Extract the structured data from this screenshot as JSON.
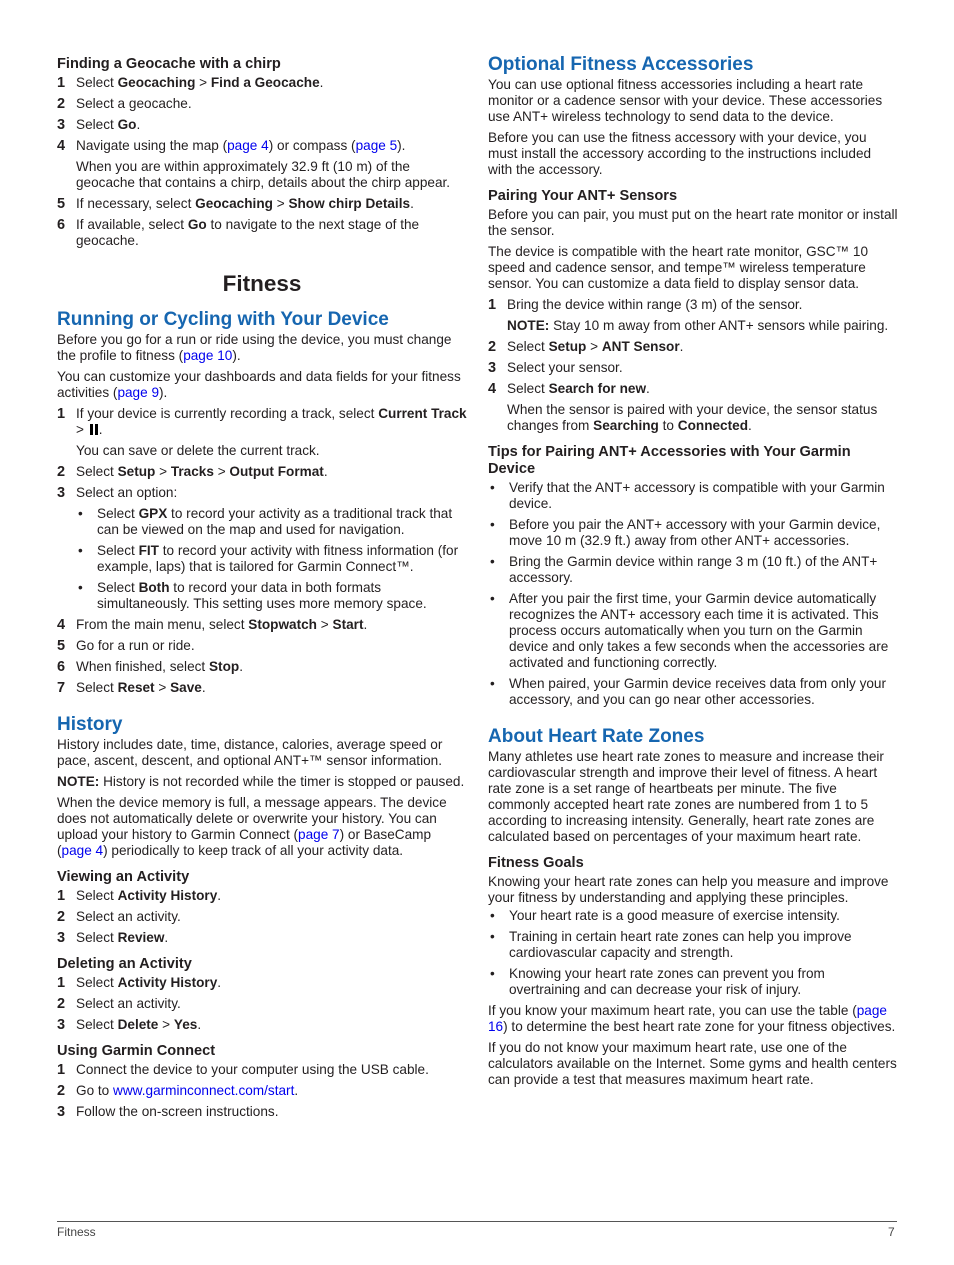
{
  "left": {
    "chirp": {
      "title": "Finding a Geocache with a chirp",
      "steps": [
        {
          "n": "1",
          "a": "Select ",
          "b1": "Geocaching",
          "c": " > ",
          "b2": "Find a Geocache",
          "d": "."
        },
        {
          "n": "2",
          "text": "Select a geocache."
        },
        {
          "n": "3",
          "a": "Select ",
          "b1": "Go",
          "d": "."
        },
        {
          "n": "4",
          "a": "Navigate using the map (",
          "link1": "page 4",
          "c": ") or compass (",
          "link2": "page 5",
          "d": ")."
        },
        {
          "n": "5",
          "a": "If necessary, select ",
          "b1": "Geocaching",
          "c": " > ",
          "b2": "Show chirp Details",
          "d": "."
        },
        {
          "n": "6",
          "a": "If available, select ",
          "b1": "Go",
          "d": " to navigate to the next stage of the geocache."
        }
      ],
      "step4_note": "When you are within approximately 32.9 ft (10 m) of the geocache that contains a chirp, details about the chirp appear."
    },
    "chapter_title": "Fitness",
    "running": {
      "title": "Running or Cycling with Your Device",
      "p1a": "Before you go for a run or ride using the device, you must change the profile to fitness (",
      "p1link": "page 10",
      "p1b": ").",
      "p2a": "You can customize your dashboards and data fields for your fitness activities (",
      "p2link": "page 9",
      "p2b": ").",
      "s1": {
        "n": "1",
        "a": "If your device is currently recording a track, select ",
        "b1": "Current Track",
        "c": " > ",
        "d": "."
      },
      "s1_note": "You can save or delete the current track.",
      "s2": {
        "n": "2",
        "a": "Select ",
        "b1": "Setup",
        "c1": " > ",
        "b2": "Tracks",
        "c2": " > ",
        "b3": "Output Format",
        "d": "."
      },
      "s3": {
        "n": "3",
        "text": "Select an option:"
      },
      "options": [
        {
          "a": "Select ",
          "b": "GPX",
          "c": " to record your activity as a traditional track that can be viewed on the map and used for navigation."
        },
        {
          "a": "Select ",
          "b": "FIT",
          "c": " to record your activity with fitness information (for example, laps) that is tailored for Garmin Connect™."
        },
        {
          "a": "Select ",
          "b": "Both",
          "c": " to record your data in both formats simultaneously. This setting uses more memory space."
        }
      ],
      "s4": {
        "n": "4",
        "a": "From the main menu, select ",
        "b1": "Stopwatch",
        "c": " > ",
        "b2": "Start",
        "d": "."
      },
      "s5": {
        "n": "5",
        "text": "Go for a run or ride."
      },
      "s6": {
        "n": "6",
        "a": "When finished, select ",
        "b1": "Stop",
        "d": "."
      },
      "s7": {
        "n": "7",
        "a": "Select ",
        "b1": "Reset",
        "c": " > ",
        "b2": "Save",
        "d": "."
      }
    },
    "history": {
      "title": "History",
      "p1": "History includes date, time, distance, calories, average speed or pace, ascent, descent, and optional ANT+™ sensor information.",
      "note_label": "NOTE:",
      "note_text": " History is not recorded while the timer is stopped or paused.",
      "p3a": "When the device memory is full, a message appears. The device does not automatically delete or overwrite your history. You can upload your history to Garmin Connect (",
      "p3link1": "page 7",
      "p3b": ") or BaseCamp (",
      "p3link2": "page 4",
      "p3c": ") periodically to keep track of all your activity data."
    },
    "viewing": {
      "title": "Viewing an Activity",
      "s1": {
        "n": "1",
        "a": "Select ",
        "b1": "Activity History",
        "d": "."
      },
      "s2": {
        "n": "2",
        "text": "Select an activity."
      },
      "s3": {
        "n": "3",
        "a": "Select ",
        "b1": "Review",
        "d": "."
      }
    },
    "deleting": {
      "title": "Deleting an Activity",
      "s1": {
        "n": "1",
        "a": "Select ",
        "b1": "Activity History",
        "d": "."
      },
      "s2": {
        "n": "2",
        "text": "Select an activity."
      },
      "s3": {
        "n": "3",
        "a": "Select ",
        "b1": "Delete",
        "c": " > ",
        "b2": "Yes",
        "d": "."
      }
    },
    "connect": {
      "title": "Using Garmin Connect",
      "s1": {
        "n": "1",
        "text": "Connect the device to your computer using the USB cable."
      },
      "s2": {
        "n": "2",
        "a": "Go to ",
        "link": "www.garminconnect.com/start",
        "d": "."
      },
      "s3": {
        "n": "3",
        "text": "Follow the on-screen instructions."
      }
    }
  },
  "right": {
    "accessories": {
      "title": "Optional Fitness Accessories",
      "p1": "You can use optional fitness accessories including a heart rate monitor or a cadence sensor with your device. These accessories use ANT+ wireless technology to send data to the device.",
      "p2": "Before you can use the fitness accessory with your device, you must install the accessory according to the instructions included with the accessory."
    },
    "pairing": {
      "title": "Pairing Your ANT+ Sensors",
      "p1": "Before you can pair, you must put on the heart rate monitor or install the sensor.",
      "p2": "The device is compatible with the heart rate monitor, GSC™ 10 speed and cadence sensor, and tempe™ wireless temperature sensor. You can customize a data field to display sensor data.",
      "s1": {
        "n": "1",
        "text": "Bring the device within range (3 m) of the sensor."
      },
      "s1_note_label": "NOTE:",
      "s1_note_text": " Stay 10 m away from other ANT+ sensors while pairing.",
      "s2": {
        "n": "2",
        "a": "Select ",
        "b1": "Setup",
        "c": " > ",
        "b2": "ANT Sensor",
        "d": "."
      },
      "s3": {
        "n": "3",
        "text": "Select your sensor."
      },
      "s4": {
        "n": "4",
        "a": "Select ",
        "b1": "Search for new",
        "d": "."
      },
      "s4_note": {
        "a": "When the sensor is paired with your device, the sensor status changes from ",
        "b1": "Searching",
        "c": " to ",
        "b2": "Connected",
        "d": "."
      }
    },
    "tips": {
      "title": "Tips for Pairing ANT+ Accessories with Your Garmin Device",
      "items": [
        "Verify that the ANT+ accessory is compatible with your Garmin device.",
        "Before you pair the ANT+ accessory with your Garmin device, move 10 m (32.9 ft.) away from other ANT+ accessories.",
        "Bring the Garmin device within range 3 m (10 ft.) of the ANT+ accessory.",
        "After you pair the first time, your Garmin device automatically recognizes the ANT+ accessory each time it is activated. This process occurs automatically when you turn on the Garmin device and only takes a few seconds when the accessories are activated and functioning correctly.",
        "When paired, your Garmin device receives data from only your accessory, and you can go near other accessories."
      ]
    },
    "zones": {
      "title": "About Heart Rate Zones",
      "p1": "Many athletes use heart rate zones to measure and increase their cardiovascular strength and improve their level of fitness. A heart rate zone is a set range of heartbeats per minute. The five commonly accepted heart rate zones are numbered from 1 to 5 according to increasing intensity. Generally, heart rate zones are calculated based on percentages of your maximum heart rate."
    },
    "goals": {
      "title": "Fitness Goals",
      "p1": "Knowing your heart rate zones can help you measure and improve your fitness by understanding and applying these principles.",
      "items": [
        "Your heart rate is a good measure of exercise intensity.",
        "Training in certain heart rate zones can help you improve cardiovascular capacity and strength.",
        "Knowing your heart rate zones can prevent you from overtraining and can decrease your risk of injury."
      ],
      "p2a": "If you know your maximum heart rate, you can use the table (",
      "p2link": "page 16",
      "p2b": ") to determine the best heart rate zone for your fitness objectives.",
      "p3": "If you do not know your maximum heart rate, use one of the calculators available on the Internet. Some gyms and health centers can provide a test that measures maximum heart rate."
    }
  },
  "footer": {
    "section": "Fitness",
    "page_number": "7"
  },
  "bullet": "•"
}
